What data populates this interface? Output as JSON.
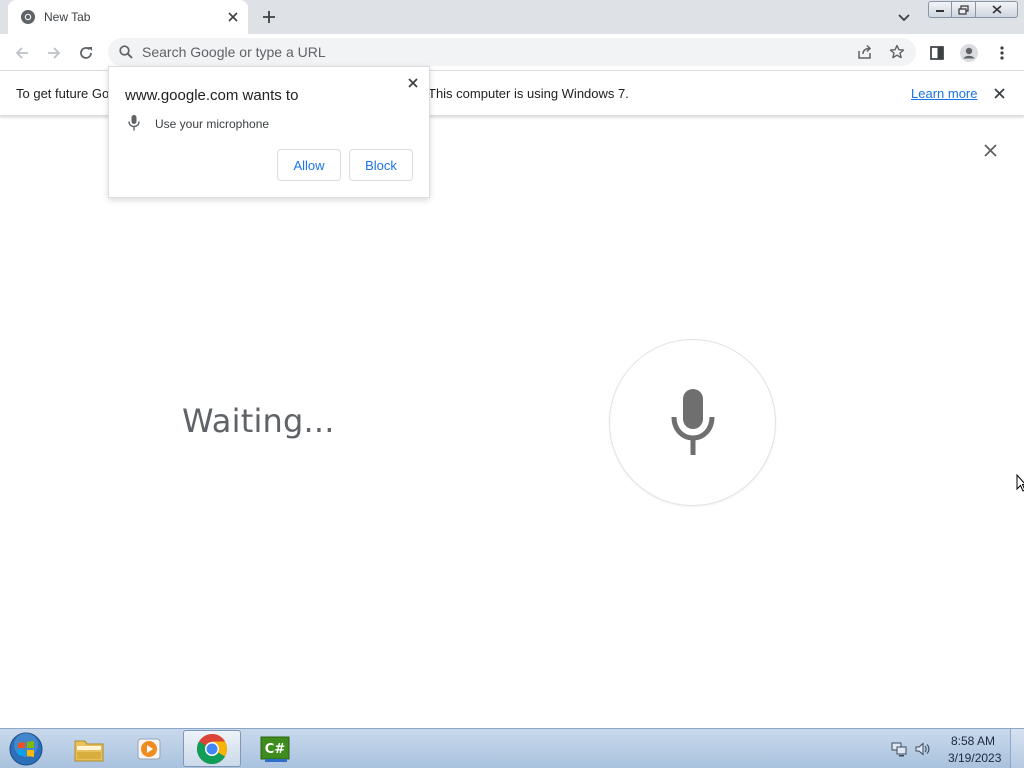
{
  "browser": {
    "tab": {
      "title": "New Tab",
      "favicon": "chrome-icon"
    },
    "omnibox": {
      "placeholder": "Search Google or type a URL",
      "value": ""
    },
    "infobar": {
      "text_before": "To get future Go",
      "text_after": "This computer is using Windows 7.",
      "link": "Learn more"
    }
  },
  "permission_prompt": {
    "title": "www.google.com wants to",
    "item": "Use your microphone",
    "allow_label": "Allow",
    "block_label": "Block"
  },
  "voice_search": {
    "status": "Waiting..."
  },
  "taskbar": {
    "apps": [
      "windows-explorer-icon",
      "media-player-icon",
      "chrome-icon",
      "csharp-icon"
    ],
    "active_app": "chrome-icon",
    "clock_time": "8:58 AM",
    "clock_date": "3/19/2023"
  },
  "colors": {
    "accent": "#1a73e8",
    "icon_gray": "#5f6368"
  }
}
